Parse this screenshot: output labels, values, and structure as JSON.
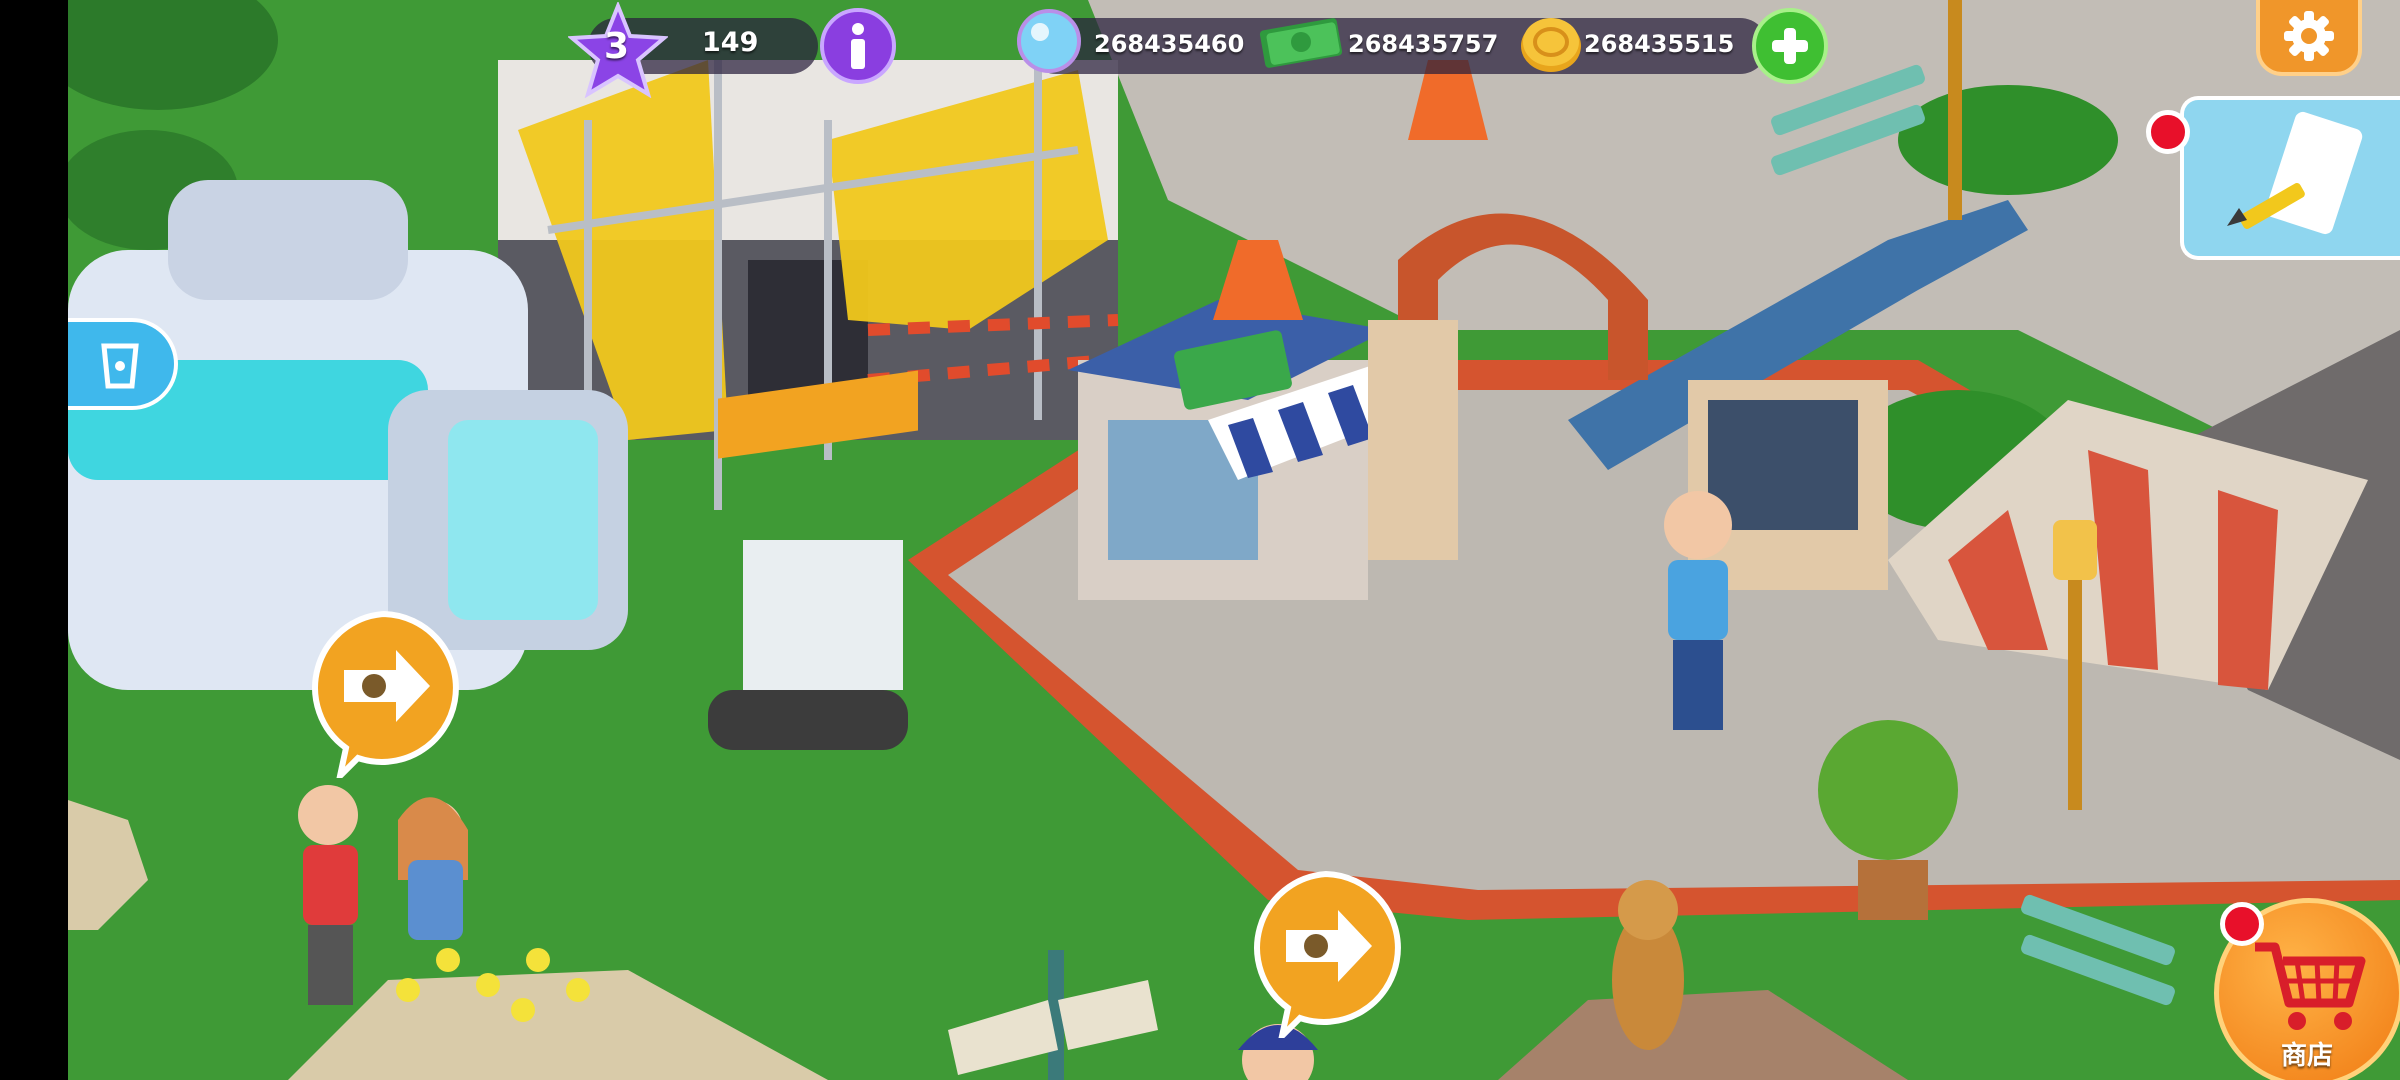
{
  "hud": {
    "level": "3",
    "xp": "149",
    "gems": "268435460",
    "cash": "268435757",
    "coins": "268435515"
  },
  "shop": {
    "label": "商店"
  },
  "icons": {
    "level": "star-icon",
    "info": "info-icon",
    "gems": "gem-icon",
    "cash": "cash-icon",
    "coins": "coin-icon",
    "add": "plus-icon",
    "settings": "gear-icon",
    "edit": "edit-icon",
    "shop": "cart-icon",
    "guide": "direction-arrow-icon",
    "side": "cup-icon"
  },
  "colors": {
    "grass": "#3f9a36",
    "pavement": "#b9b4ad",
    "brick": "#d5542f",
    "accent_orange": "#f6a31c",
    "settings_orange": "#f0962a",
    "purple": "#8a3ee0",
    "green_plus": "#3fbf32"
  }
}
